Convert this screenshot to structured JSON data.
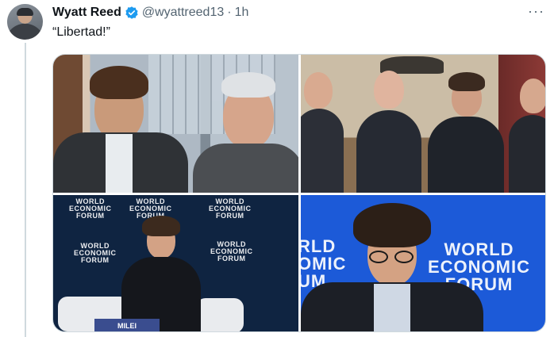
{
  "author": {
    "name": "Wyatt Reed",
    "handle": "@wyattreed13",
    "separator": "·",
    "time": "1h",
    "verified_icon": "verified-badge-icon"
  },
  "tweet": {
    "text": "“Libertad!”"
  },
  "menu_icon": "more-options-icon",
  "media": {
    "photos": [
      {
        "label": "photo-1"
      },
      {
        "label": "photo-2"
      },
      {
        "label": "photo-3",
        "wef_text": [
          "WORLD",
          "ECONOMIC",
          "FORUM"
        ],
        "nameplate": "MILEI"
      },
      {
        "label": "photo-4",
        "wef_text": [
          "WORLD",
          "ECONOMIC",
          "FORUM"
        ],
        "side_text": [
          "RLD",
          "OMIC",
          "UM"
        ]
      }
    ]
  },
  "colors": {
    "accent": "#1d9bf0",
    "text": "#0f1419",
    "muted": "#536471",
    "wef_dark": "#0f2441",
    "wef_blue": "#1c5ad8"
  }
}
